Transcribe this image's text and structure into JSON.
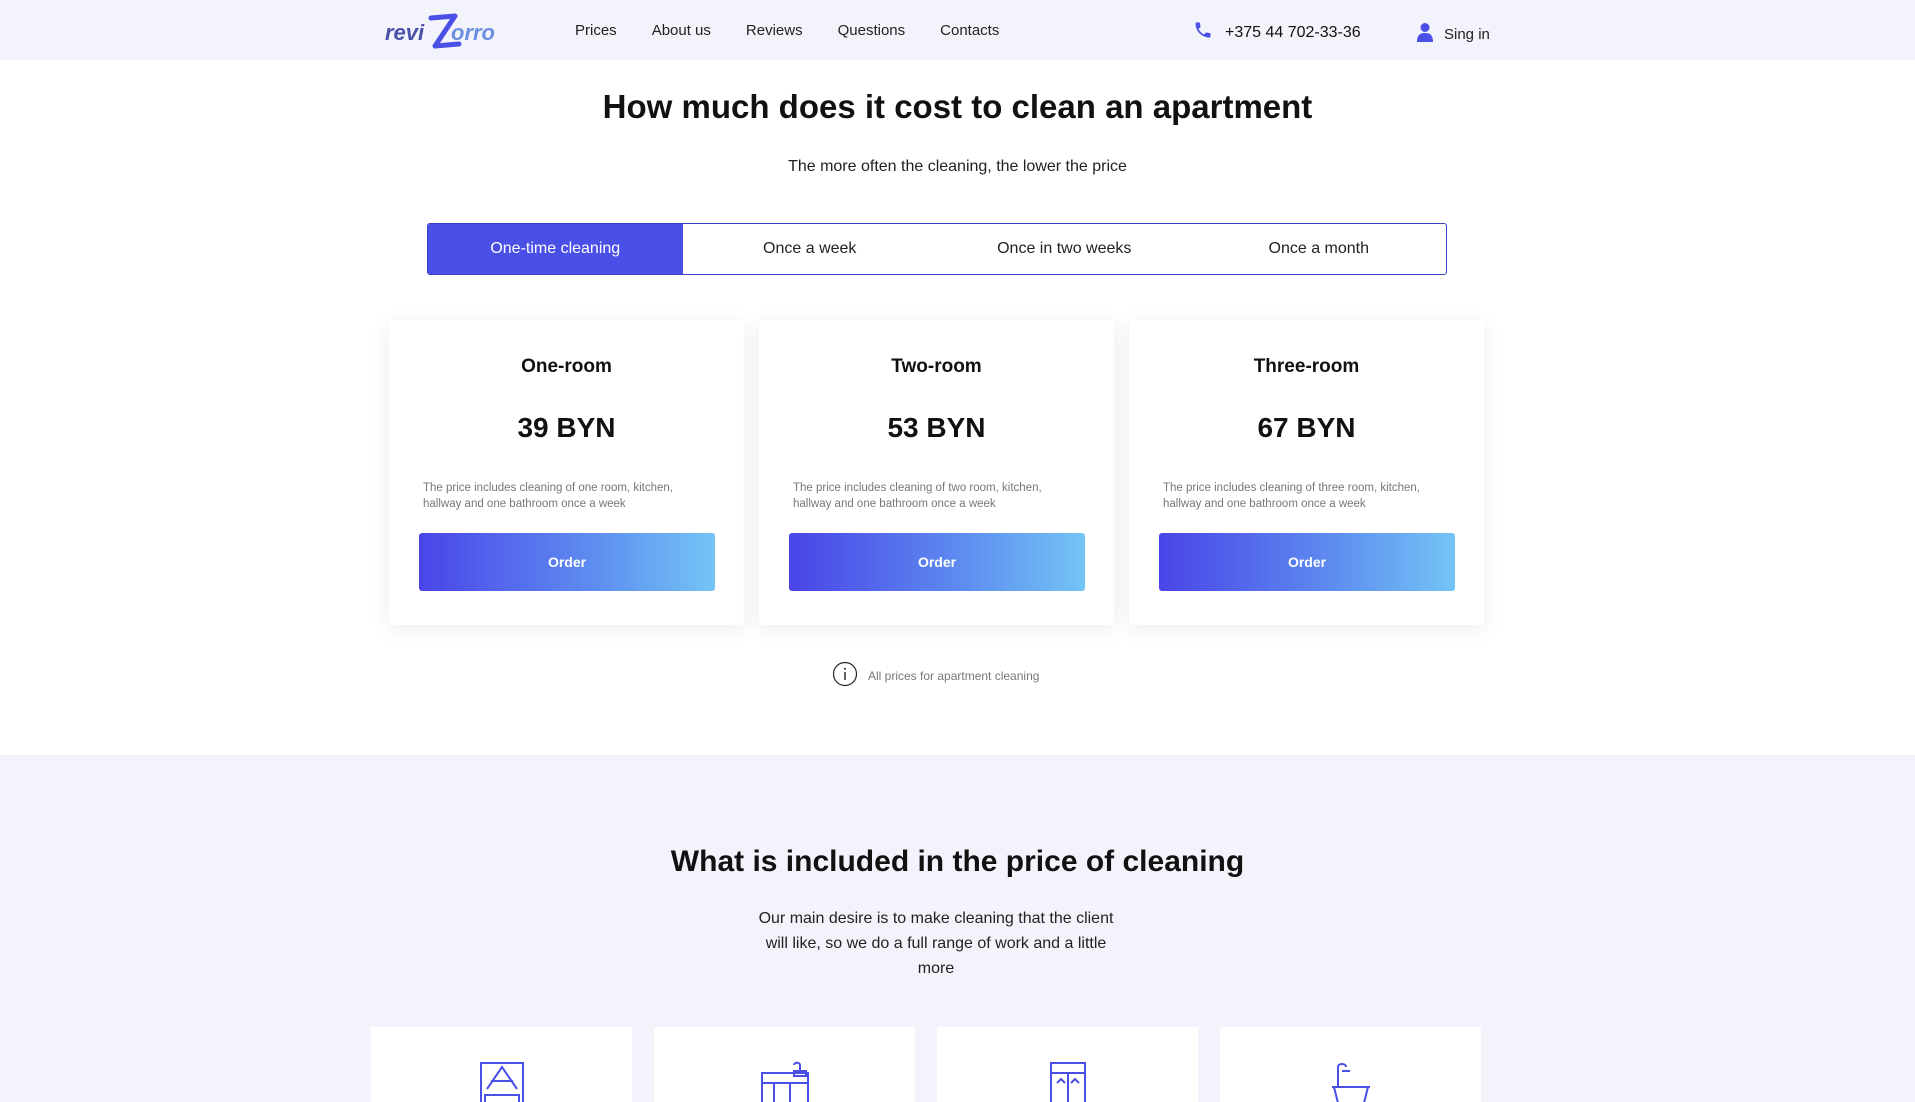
{
  "header": {
    "logo_text_left": "revi",
    "logo_text_right": "orro",
    "nav": [
      "Prices",
      "About us",
      "Reviews",
      "Questions",
      "Contacts"
    ],
    "phone": "+375 44 702-33-36",
    "signin": "Sing in",
    "icons": {
      "phone": "phone-icon",
      "user": "user-icon"
    }
  },
  "pricing": {
    "title": "How much does it cost to clean an apartment",
    "subtitle": "The more often the cleaning, the lower the price",
    "tabs": [
      "One-time cleaning",
      "Once a week",
      "Once in two weeks",
      "Once a month"
    ],
    "active_tab": "One-time cleaning",
    "cards": [
      {
        "title": "One-room",
        "price": "39 BYN",
        "description": "The price includes cleaning of one room, kitchen, hallway and one bathroom once a week",
        "button": "Order"
      },
      {
        "title": "Two-room",
        "price": "53 BYN",
        "description": "The price includes cleaning of two room, kitchen, hallway and one bathroom once a week",
        "button": "Order"
      },
      {
        "title": "Three-room",
        "price": "67 BYN",
        "description": "The price includes cleaning of three room, kitchen, hallway and one bathroom once a week",
        "button": "Order"
      }
    ],
    "note": "All prices for apartment cleaning"
  },
  "included": {
    "title": "What is included in the price of cleaning",
    "text": "Our main desire is to make cleaning that the client will like, so we do a full range of work and a little more",
    "icons": [
      "bedroom-icon",
      "kitchen-icon",
      "hallway-icon",
      "bathroom-icon"
    ]
  },
  "colors": {
    "accent": "#4a4fe6",
    "header_bg": "#f3f3fb",
    "gradient_start": "#4a44e8",
    "gradient_end": "#74c4f5"
  }
}
